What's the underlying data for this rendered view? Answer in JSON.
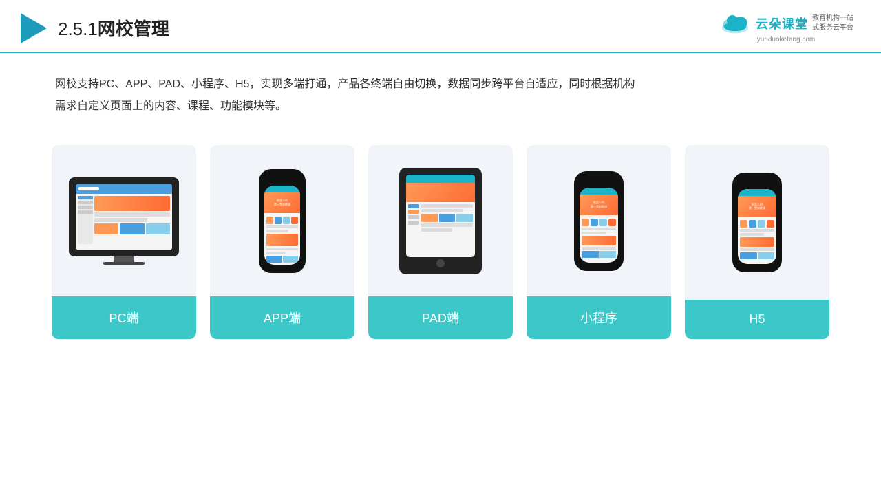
{
  "header": {
    "title": "2.5.1网校管理",
    "title_prefix": "2.5.1",
    "title_main": "网校管理"
  },
  "logo": {
    "name": "云朵课堂",
    "domain": "yunduoketang.com",
    "tagline": "教育机构一站\n式服务云平台"
  },
  "description": {
    "text": "网校支持PC、APP、PAD、小程序、H5，实现多端打通，产品各终端自由切换，数据同步跨平台自适应，同时根据机构需求自定义页面上的内容、课程、功能模块等。"
  },
  "cards": [
    {
      "id": "pc",
      "label": "PC端"
    },
    {
      "id": "app",
      "label": "APP端"
    },
    {
      "id": "pad",
      "label": "PAD端"
    },
    {
      "id": "miniprogram",
      "label": "小程序"
    },
    {
      "id": "h5",
      "label": "H5"
    }
  ],
  "colors": {
    "accent": "#1ab3c8",
    "card_bg": "#edf2f7",
    "label_bg": "#3cc8c8",
    "header_border": "#1ab3c8"
  }
}
